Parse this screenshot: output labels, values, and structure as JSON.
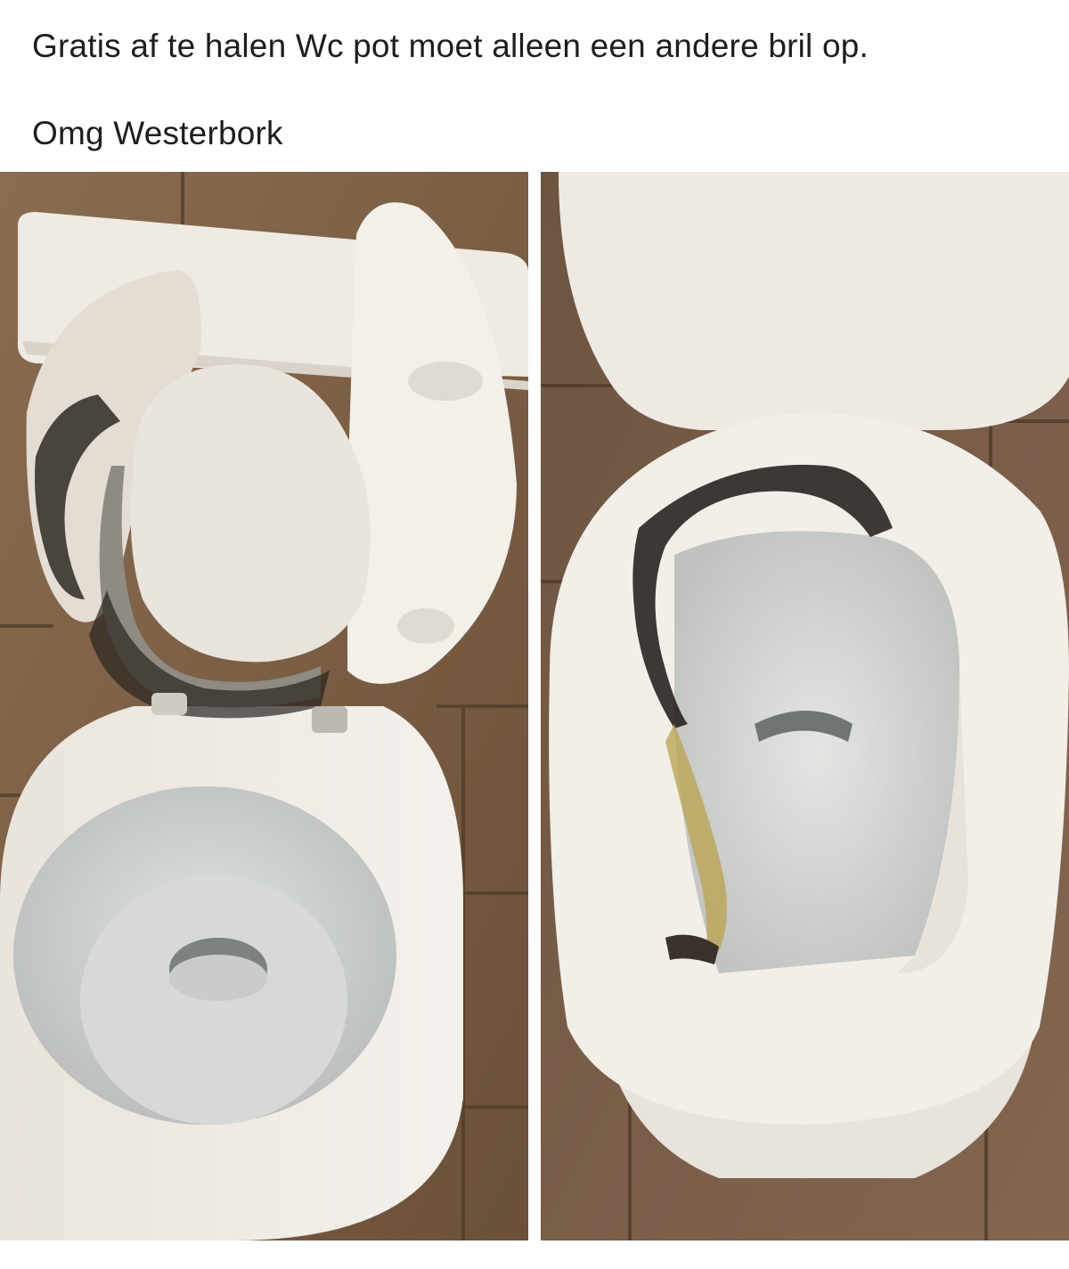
{
  "post": {
    "line1": "Gratis af te halen Wc pot moet alleen een andere bril op.",
    "line2": "Omg Westerbork"
  },
  "photos": [
    {
      "name": "photo-left"
    },
    {
      "name": "photo-right"
    }
  ],
  "colors": {
    "background": "#ffffff",
    "text": "#1c1e21",
    "tile": "#7a5f45",
    "porcelain": "#ece7df",
    "burn": "#2a2420"
  }
}
